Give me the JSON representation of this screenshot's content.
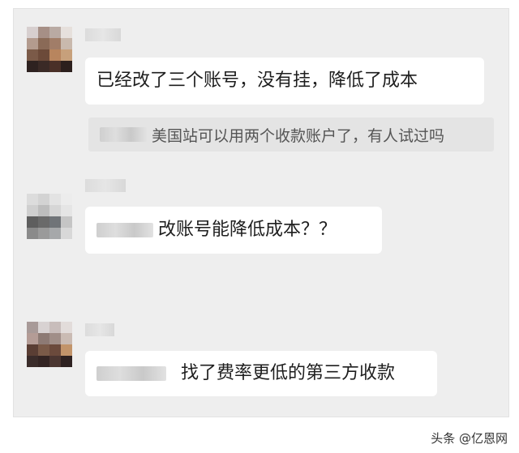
{
  "messages": [
    {
      "text": "已经改了三个账号，没有挂，降低了成本"
    },
    {
      "quote": "美国站可以用两个收款账户了，有人试过吗"
    },
    {
      "text": "改账号能降低成本？？"
    },
    {
      "text": "找了费率更低的第三方收款"
    }
  ],
  "watermark": {
    "text": "头条 @亿恩网"
  }
}
